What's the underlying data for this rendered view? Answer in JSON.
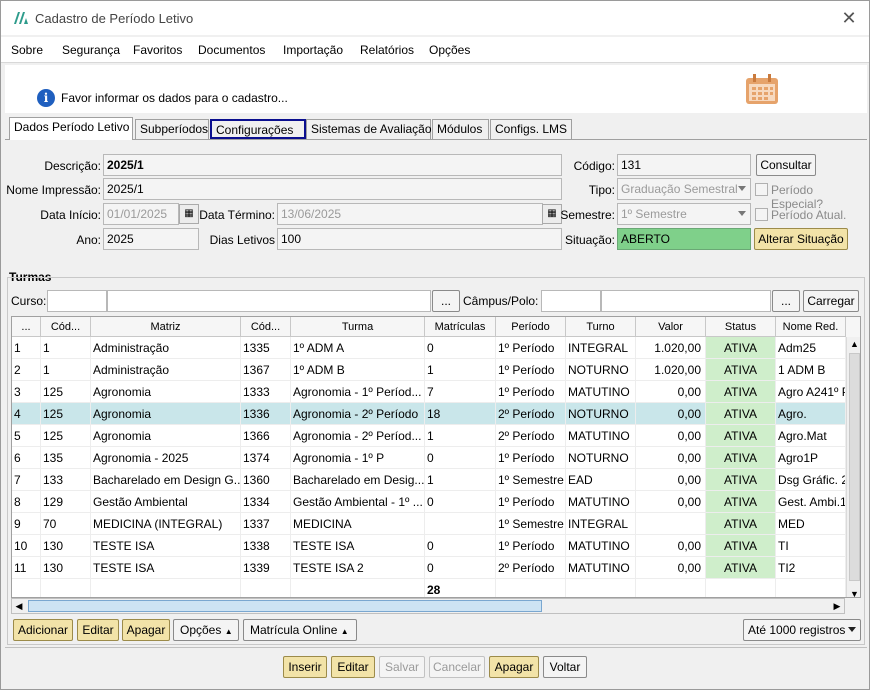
{
  "window": {
    "title": "Cadastro de Período Letivo"
  },
  "menu": [
    "Sobre",
    "Segurança",
    "Favoritos",
    "Documentos",
    "Importação",
    "Relatórios",
    "Opções"
  ],
  "info": {
    "message": "Favor informar os dados para o cadastro..."
  },
  "tabs": [
    "Dados Período Letivo",
    "Subperíodos",
    "Configurações",
    "Sistemas de Avaliação",
    "Módulos",
    "Configs. LMS"
  ],
  "form": {
    "descricao_label": "Descrição:",
    "descricao": "2025/1",
    "nome_impressao_label": "Nome Impressão:",
    "nome_impressao": "2025/1",
    "data_inicio_label": "Data Início:",
    "data_inicio": "01/01/2025",
    "data_termino_label": "Data Término:",
    "data_termino": "13/06/2025",
    "ano_label": "Ano:",
    "ano": "2025",
    "dias_letivos_label": "Dias Letivos",
    "dias_letivos": "100",
    "codigo_label": "Código:",
    "codigo": "131",
    "consultar": "Consultar",
    "tipo_label": "Tipo:",
    "tipo": "Graduação Semestral",
    "periodo_especial": "Período Especial?",
    "semestre_label": "Semestre:",
    "semestre": "1º Semestre",
    "periodo_atual": "Período Atual.",
    "situacao_label": "Situação:",
    "situacao": "ABERTO",
    "alterar_situacao": "Alterar Situação"
  },
  "turmas": {
    "title": "Turmas",
    "curso_label": "Curso:",
    "campus_label": "Câmpus/Polo:",
    "ellipsis": "...",
    "carregar": "Carregar",
    "columns": [
      "...",
      "Cód...",
      "Matriz",
      "Cód...",
      "Turma",
      "Matrículas",
      "Período",
      "Turno",
      "Valor",
      "Status",
      "Nome Red."
    ],
    "rows": [
      [
        "1",
        "1",
        "Administração",
        "1335",
        "1º ADM A",
        "0",
        "1º Período",
        "INTEGRAL",
        "1.020,00",
        "ATIVA",
        "Adm25"
      ],
      [
        "2",
        "1",
        "Administração",
        "1367",
        "1º ADM B",
        "1",
        "1º Período",
        "NOTURNO",
        "1.020,00",
        "ATIVA",
        "1 ADM B"
      ],
      [
        "3",
        "125",
        "Agronomia",
        "1333",
        "Agronomia - 1º Períod...",
        "7",
        "1º Período",
        "MATUTINO",
        "0,00",
        "ATIVA",
        "Agro A241º P"
      ],
      [
        "4",
        "125",
        "Agronomia",
        "1336",
        "Agronomia - 2º Período",
        "18",
        "2º Período",
        "NOTURNO",
        "0,00",
        "ATIVA",
        "Agro."
      ],
      [
        "5",
        "125",
        "Agronomia",
        "1366",
        "Agronomia - 2º Períod...",
        "1",
        "2º Período",
        "MATUTINO",
        "0,00",
        "ATIVA",
        "Agro.Mat"
      ],
      [
        "6",
        "135",
        "Agronomia - 2025",
        "1374",
        "Agronomia - 1º P",
        "0",
        "1º Período",
        "NOTURNO",
        "0,00",
        "ATIVA",
        "Agro1P"
      ],
      [
        "7",
        "133",
        "Bacharelado em Design G...",
        "1360",
        "Bacharelado em Desig...",
        "1",
        "1º Semestre",
        "EAD",
        "0,00",
        "ATIVA",
        "Dsg Gráfic. 2"
      ],
      [
        "8",
        "129",
        "Gestão Ambiental",
        "1334",
        "Gestão Ambiental - 1º ...",
        "0",
        "1º Período",
        "MATUTINO",
        "0,00",
        "ATIVA",
        "Gest. Ambi.1"
      ],
      [
        "9",
        "70",
        "MEDICINA (INTEGRAL)",
        "1337",
        "MEDICINA",
        "",
        "1º Semestre",
        "INTEGRAL",
        "",
        "ATIVA",
        "MED"
      ],
      [
        "10",
        "130",
        "TESTE ISA",
        "1338",
        "TESTE ISA",
        "0",
        "1º Período",
        "MATUTINO",
        "0,00",
        "ATIVA",
        "TI"
      ],
      [
        "11",
        "130",
        "TESTE ISA",
        "1339",
        "TESTE ISA 2",
        "0",
        "2º Período",
        "MATUTINO",
        "0,00",
        "ATIVA",
        "TI2"
      ]
    ],
    "total_matriculas": "28",
    "selected_row": 4
  },
  "grid_buttons": {
    "adicionar": "Adicionar",
    "editar": "Editar",
    "apagar": "Apagar",
    "opcoes": "Opções",
    "matricula_online": "Matrícula Online",
    "registros": "Até 1000 registros"
  },
  "footer": {
    "inserir": "Inserir",
    "editar": "Editar",
    "salvar": "Salvar",
    "cancelar": "Cancelar",
    "apagar": "Apagar",
    "voltar": "Voltar"
  },
  "colors": {
    "accent_yellow": "#f2e3a8",
    "status_green": "#cfeecb",
    "situacao_green": "#7fd08a",
    "selected_row": "#c9e6ea",
    "tab_focus": "#0b0f8f"
  }
}
